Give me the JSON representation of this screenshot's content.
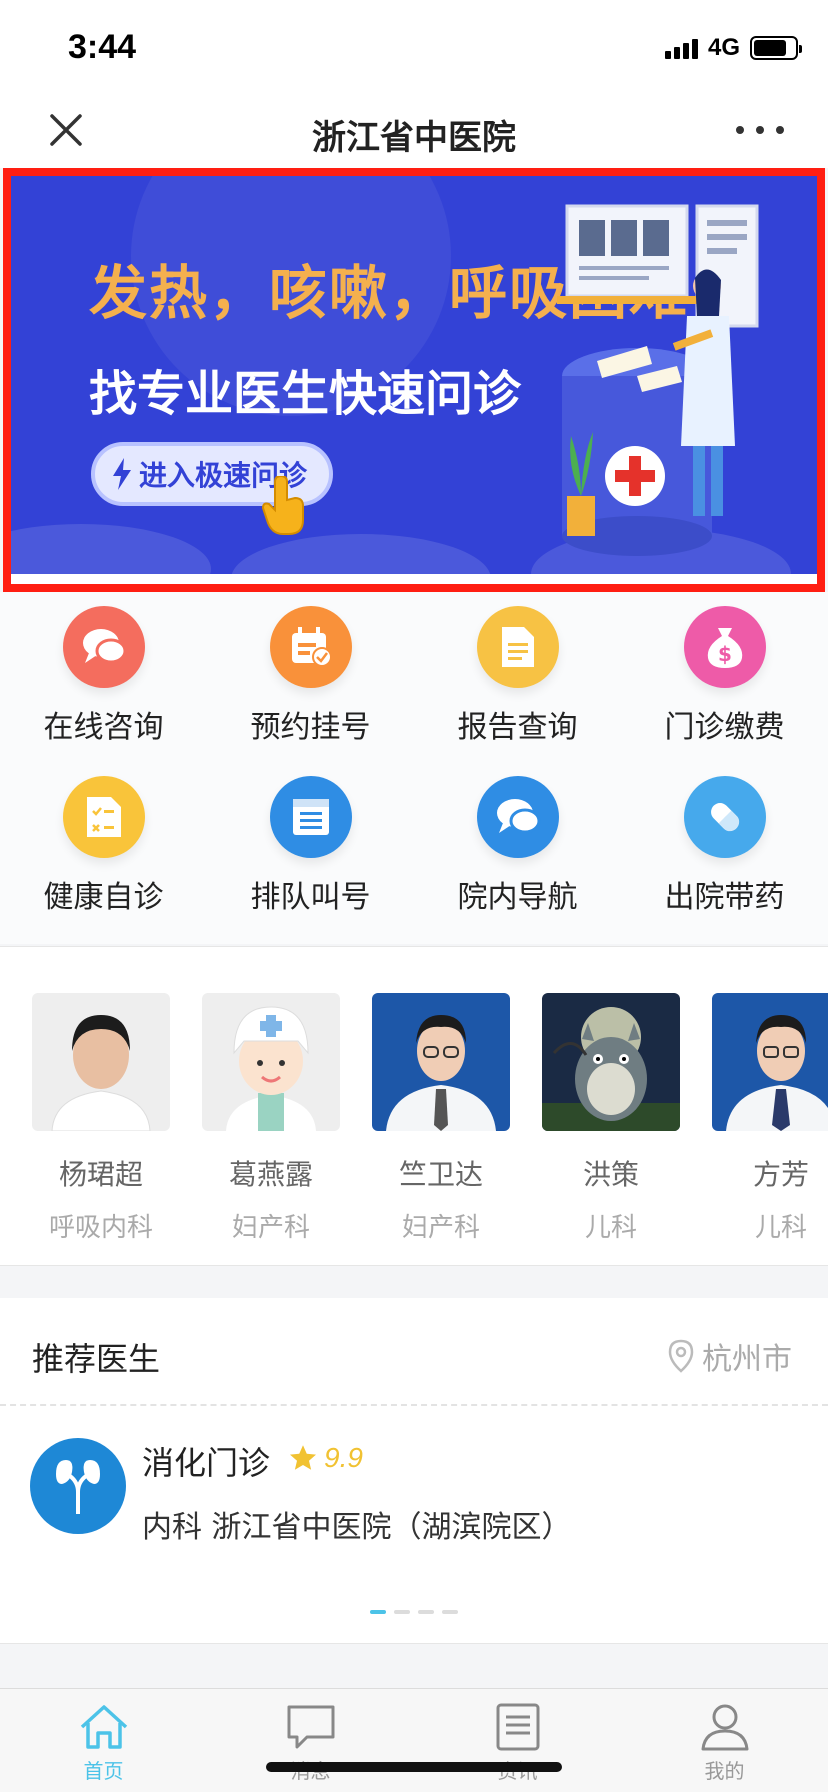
{
  "status_bar": {
    "time": "3:44",
    "network": "4G"
  },
  "nav": {
    "title": "浙江省中医院"
  },
  "banner": {
    "headline": "发热，咳嗽，呼吸困难",
    "subline": "找专业医生快速问诊",
    "button_label": "进入极速问诊"
  },
  "menu": {
    "items": [
      {
        "label": "在线咨询",
        "icon": "chat-bubbles-icon",
        "color": "#f46d5e"
      },
      {
        "label": "预约挂号",
        "icon": "calendar-check-icon",
        "color": "#f9913a"
      },
      {
        "label": "报告查询",
        "icon": "document-icon",
        "color": "#f7c244"
      },
      {
        "label": "门诊缴费",
        "icon": "money-bag-icon",
        "color": "#ee5ba8"
      },
      {
        "label": "健康自诊",
        "icon": "checklist-icon",
        "color": "#f9c43a"
      },
      {
        "label": "排队叫号",
        "icon": "queue-list-icon",
        "color": "#2f8de4"
      },
      {
        "label": "院内导航",
        "icon": "chat-bubbles-icon",
        "color": "#2f8de4"
      },
      {
        "label": "出院带药",
        "icon": "pill-icon",
        "color": "#46a9ec"
      }
    ]
  },
  "doctors": [
    {
      "name": "杨珺超",
      "dept": "呼吸内科"
    },
    {
      "name": "葛燕露",
      "dept": "妇产科"
    },
    {
      "name": "竺卫达",
      "dept": "妇产科"
    },
    {
      "name": "洪策",
      "dept": "儿科"
    },
    {
      "name": "方芳",
      "dept": "儿科"
    }
  ],
  "recommend": {
    "title": "推荐医生",
    "city": "杭州市",
    "clinic_name": "消化门诊",
    "rating": "9.9",
    "info": "内科 浙江省中医院（湖滨院区）"
  },
  "tabbar": {
    "items": [
      {
        "label": "首页",
        "active": true
      },
      {
        "label": "消息",
        "active": false
      },
      {
        "label": "资讯",
        "active": false
      },
      {
        "label": "我的",
        "active": false
      }
    ]
  },
  "colors": {
    "accent": "#4cc3e8",
    "banner_bg": "#3342d6",
    "banner_headline": "#f4b04e",
    "highlight_border": "#ff1e12"
  }
}
